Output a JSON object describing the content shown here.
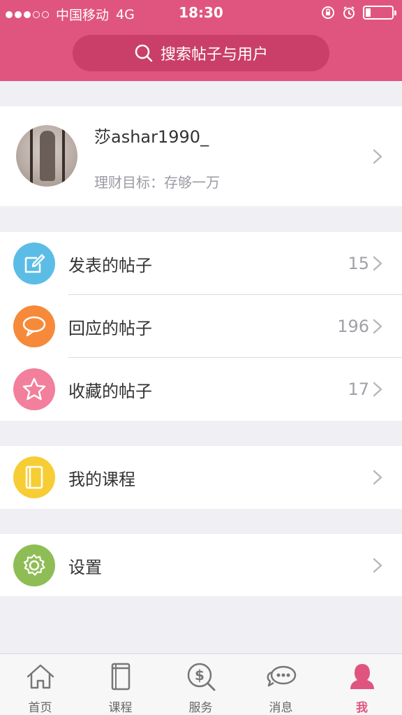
{
  "status_bar": {
    "carrier": "中国移动",
    "network": "4G",
    "time": "18:30",
    "signal_filled": 3,
    "signal_total": 5,
    "battery_level": 0.2
  },
  "search": {
    "placeholder": "搜索帖子与用户",
    "icon": "search-icon"
  },
  "profile": {
    "username": "莎ashar1990_",
    "goal": "理财目标：存够一万"
  },
  "posts_section": [
    {
      "label": "发表的帖子",
      "count": "15",
      "icon": "edit-icon",
      "color": "#5bbde6"
    },
    {
      "label": "回应的帖子",
      "count": "196",
      "icon": "chat-bubble-icon",
      "color": "#f68a3a"
    },
    {
      "label": "收藏的帖子",
      "count": "17",
      "icon": "star-icon",
      "color": "#f27f9b"
    }
  ],
  "courses_item": {
    "label": "我的课程",
    "icon": "book-icon",
    "color": "#f7cd35"
  },
  "settings_item": {
    "label": "设置",
    "icon": "gear-icon",
    "color": "#8fbd55"
  },
  "tabbar": [
    {
      "label": "首页",
      "icon": "home-icon",
      "active": false
    },
    {
      "label": "课程",
      "icon": "course-icon",
      "active": false
    },
    {
      "label": "服务",
      "icon": "service-icon",
      "active": false
    },
    {
      "label": "消息",
      "icon": "message-icon",
      "active": false
    },
    {
      "label": "我",
      "icon": "person-icon",
      "active": true
    }
  ],
  "colors": {
    "brand": "#e0557f",
    "search_bg": "#c93f69",
    "page_bg": "#efeff4"
  }
}
